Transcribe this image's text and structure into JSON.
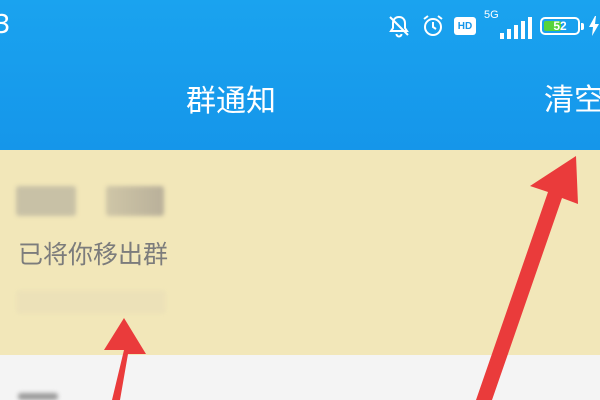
{
  "status_bar": {
    "time_fragment": "3",
    "network_label": "5G",
    "hd_label": "HD",
    "battery_level": "52",
    "battery_fraction": 0.52
  },
  "header": {
    "title": "群通知",
    "clear_label": "清空"
  },
  "notification": {
    "message": "已将你移出群"
  },
  "colors": {
    "header_blue": "#1596ea",
    "notice_bg": "#f2e7b9",
    "arrow_red": "#ea3b3b",
    "battery_green": "#57d33a"
  }
}
